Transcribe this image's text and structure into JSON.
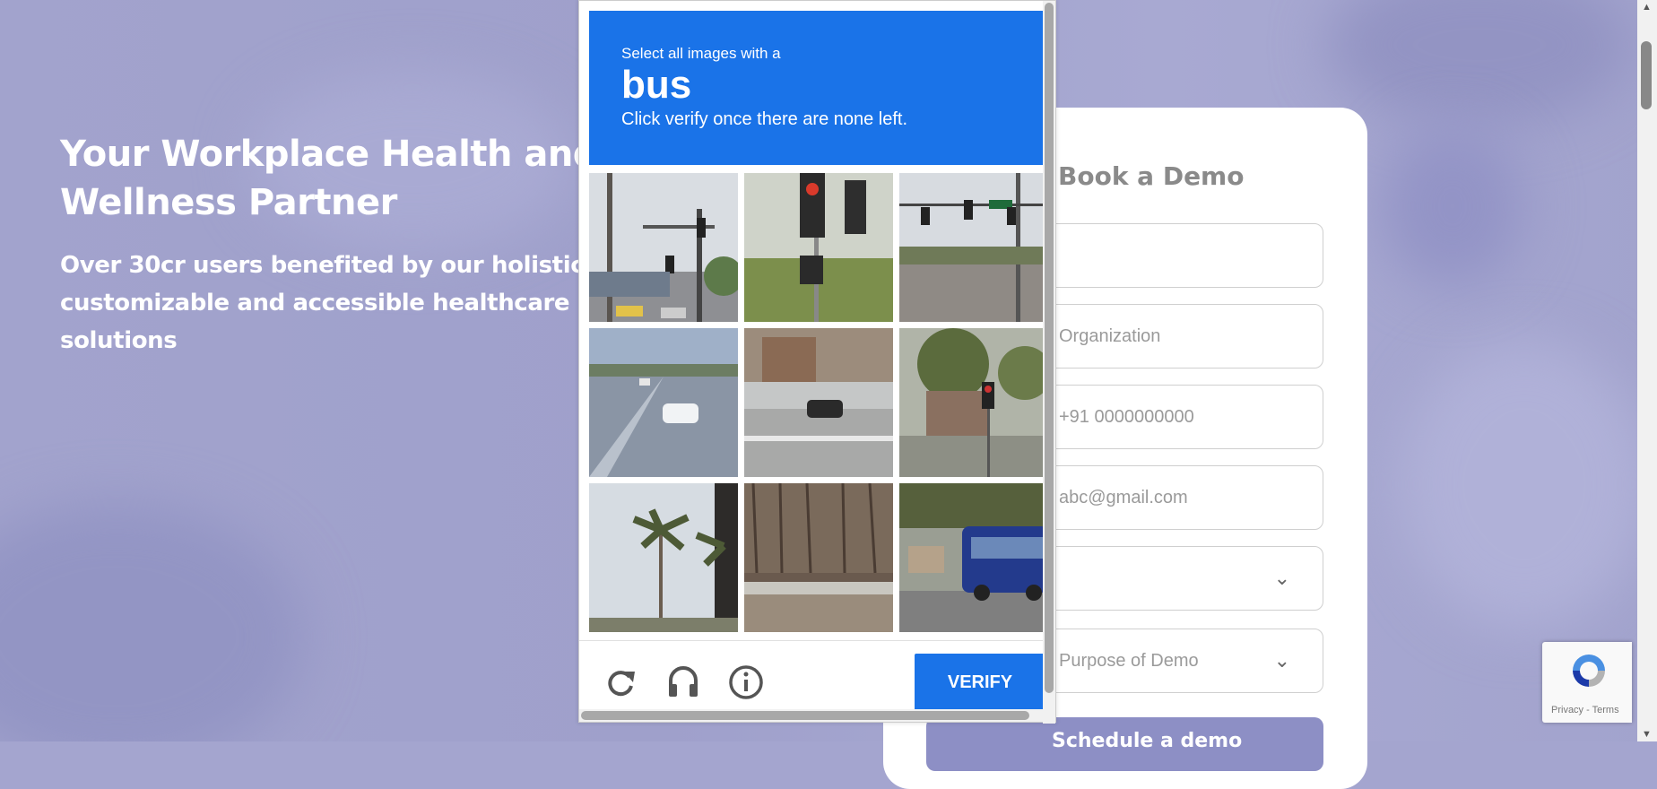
{
  "hero": {
    "title": "Your Workplace Health and Wellness Partner",
    "subtitle": "Over 30cr users benefited by our holistic, customizable and accessible healthcare solutions"
  },
  "form": {
    "title": "Book a Demo",
    "fields": [
      {
        "placeholder": ""
      },
      {
        "placeholder": "Organization"
      },
      {
        "placeholder": "+91 0000000000"
      },
      {
        "placeholder": "abc@gmail.com"
      },
      {
        "placeholder": ""
      },
      {
        "placeholder": "Purpose of Demo"
      }
    ],
    "submit_label": "Schedule a demo"
  },
  "captcha": {
    "instruction_line1": "Select all images with a",
    "target_object": "bus",
    "instruction_line3": "Click verify once there are none left.",
    "verify_label": "VERIFY",
    "tiles": [
      "traffic-light-street-with-cars",
      "traffic-light-red-closeup",
      "intersection-with-traffic-lights",
      "highway-white-car",
      "intersection-black-car",
      "traffic-light-with-trees",
      "palm-trees",
      "guardrail-forest",
      "blue-bus-on-street"
    ]
  },
  "recaptcha_badge": {
    "links": "Privacy - Terms"
  },
  "colors": {
    "captcha_blue": "#1a73e8",
    "background_lavender": "#a4a5cf",
    "submit_button": "#8d8fc5"
  }
}
